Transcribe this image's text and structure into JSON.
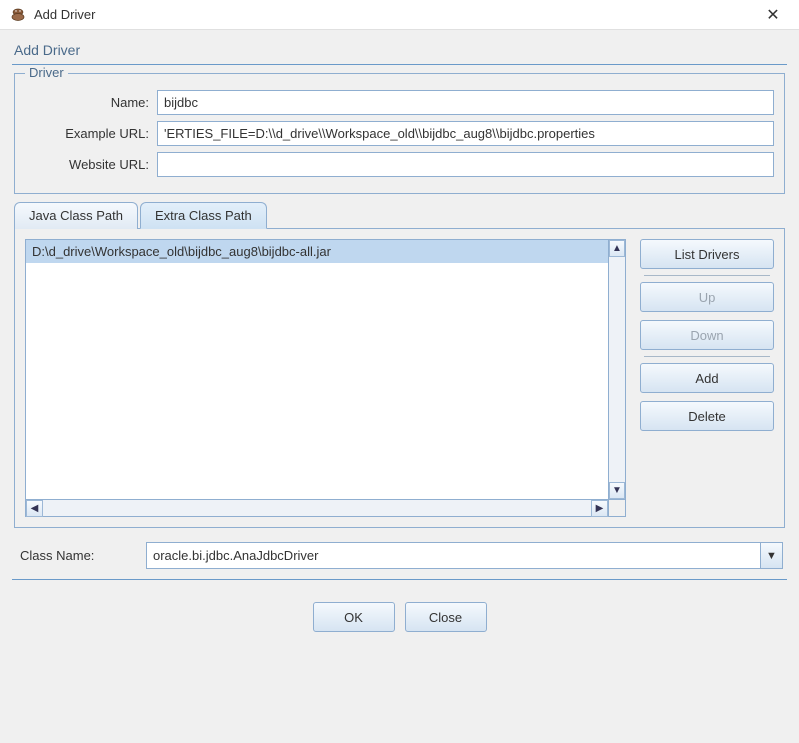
{
  "window": {
    "title": "Add Driver",
    "close_tooltip": "Close"
  },
  "header": {
    "title": "Add Driver"
  },
  "driver_group": {
    "legend": "Driver",
    "name_label": "Name:",
    "name_value": "bijdbc",
    "example_url_label": "Example URL:",
    "example_url_value": "'ERTIES_FILE=D:\\\\d_drive\\\\Workspace_old\\\\bijdbc_aug8\\\\bijdbc.properties",
    "website_url_label": "Website URL:",
    "website_url_value": ""
  },
  "tabs": {
    "java_class_path": "Java Class Path",
    "extra_class_path": "Extra Class Path"
  },
  "extra_class_path_list": {
    "items": [
      {
        "path": "D:\\d_drive\\Workspace_old\\bijdbc_aug8\\bijdbc-all.jar",
        "selected": true
      }
    ]
  },
  "side": {
    "list_drivers": "List Drivers",
    "up": "Up",
    "down": "Down",
    "add": "Add",
    "delete": "Delete"
  },
  "class_name": {
    "label": "Class Name:",
    "value": "oracle.bi.jdbc.AnaJdbcDriver"
  },
  "footer": {
    "ok": "OK",
    "close": "Close"
  }
}
